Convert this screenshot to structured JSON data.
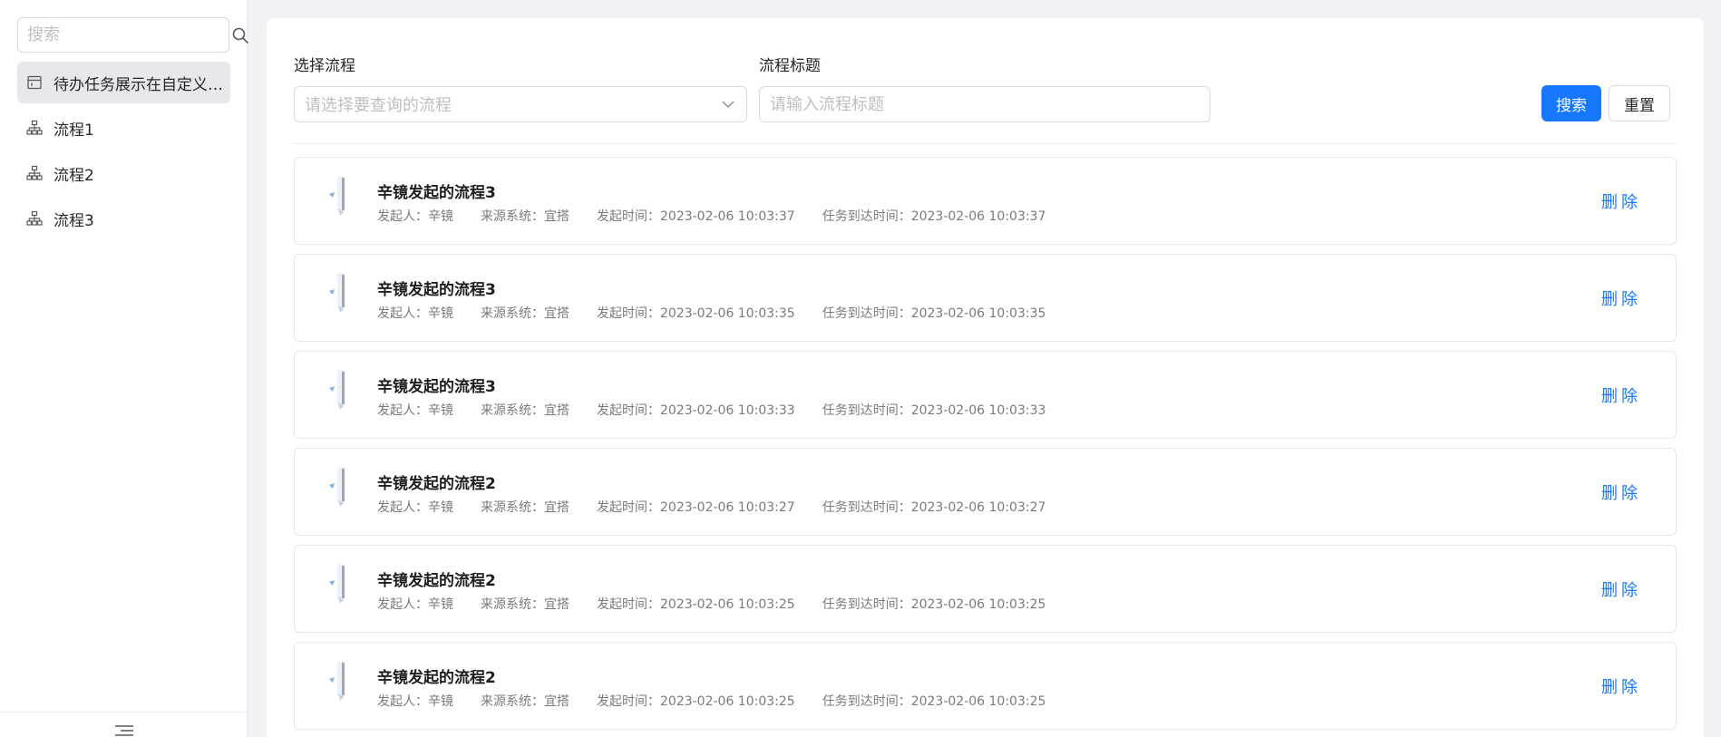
{
  "sidebar": {
    "search": {
      "placeholder": "搜索"
    },
    "items": [
      {
        "label": "待办任务展示在自定义视图…",
        "icon": "calendar-icon",
        "active": true
      },
      {
        "label": "流程1",
        "icon": "org-chart-icon",
        "active": false
      },
      {
        "label": "流程2",
        "icon": "org-chart-icon",
        "active": false
      },
      {
        "label": "流程3",
        "icon": "org-chart-icon",
        "active": false
      }
    ],
    "bottom_icon": "collapse-menu-icon"
  },
  "filters": {
    "process_label": "选择流程",
    "process_placeholder": "请选择要查询的流程",
    "title_label": "流程标题",
    "title_placeholder": "请输入流程标题",
    "search_button": "搜索",
    "reset_button": "重置"
  },
  "meta_labels": {
    "initiator": "发起人：",
    "source": "来源系统：",
    "start_time": "发起时间：",
    "arrive_time": "任务到达时间："
  },
  "tasks": [
    {
      "title": "辛镜发起的流程3",
      "initiator": "辛镜",
      "source": "宜搭",
      "start_time": "2023-02-06 10:03:37",
      "arrive_time": "2023-02-06 10:03:37",
      "action": "删除"
    },
    {
      "title": "辛镜发起的流程3",
      "initiator": "辛镜",
      "source": "宜搭",
      "start_time": "2023-02-06 10:03:35",
      "arrive_time": "2023-02-06 10:03:35",
      "action": "删除"
    },
    {
      "title": "辛镜发起的流程3",
      "initiator": "辛镜",
      "source": "宜搭",
      "start_time": "2023-02-06 10:03:33",
      "arrive_time": "2023-02-06 10:03:33",
      "action": "删除"
    },
    {
      "title": "辛镜发起的流程2",
      "initiator": "辛镜",
      "source": "宜搭",
      "start_time": "2023-02-06 10:03:27",
      "arrive_time": "2023-02-06 10:03:27",
      "action": "删除"
    },
    {
      "title": "辛镜发起的流程2",
      "initiator": "辛镜",
      "source": "宜搭",
      "start_time": "2023-02-06 10:03:25",
      "arrive_time": "2023-02-06 10:03:25",
      "action": "删除"
    },
    {
      "title": "辛镜发起的流程2",
      "initiator": "辛镜",
      "source": "宜搭",
      "start_time": "2023-02-06 10:03:25",
      "arrive_time": "2023-02-06 10:03:25",
      "action": "删除"
    }
  ],
  "colors": {
    "accent": "#1677ff",
    "active_bg": "#e6e8eb"
  }
}
